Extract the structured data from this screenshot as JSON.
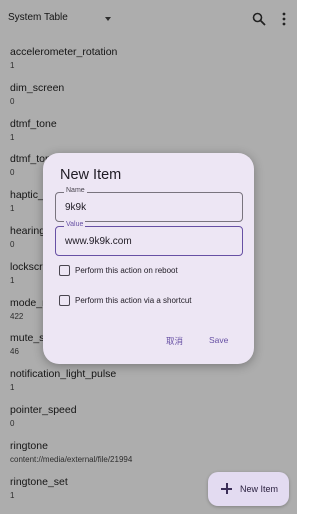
{
  "toolbar": {
    "table_selector": "System Table",
    "icons": [
      "chevron-down-icon",
      "search-icon",
      "more-vert-icon"
    ]
  },
  "settings": [
    {
      "key": "accelerometer_rotation",
      "value": "1"
    },
    {
      "key": "dim_screen",
      "value": "0"
    },
    {
      "key": "dtmf_tone",
      "value": "1"
    },
    {
      "key": "dtmf_tone_type",
      "value": "0"
    },
    {
      "key": "haptic_feedback_enabled",
      "value": "1"
    },
    {
      "key": "hearing_aid",
      "value": "0"
    },
    {
      "key": "lockscreen_sounds_enabled",
      "value": "1"
    },
    {
      "key": "mode_ringer_streams_affected",
      "value": "422"
    },
    {
      "key": "mute_streams_affected",
      "value": "46"
    },
    {
      "key": "notification_light_pulse",
      "value": "1"
    },
    {
      "key": "pointer_speed",
      "value": "0"
    },
    {
      "key": "ringtone",
      "value": "content://media/external/file/21994"
    },
    {
      "key": "ringtone_set",
      "value": "1"
    }
  ],
  "dialog": {
    "title": "New Item",
    "name_label": "Name",
    "name_value": "9k9k",
    "value_label": "Value",
    "value_value": "www.9k9k.com",
    "option_reboot": "Perform this action on reboot",
    "option_shortcut": "Perform this action via a shortcut",
    "cancel_label": "取消",
    "save_label": "Save"
  },
  "fab": {
    "label": "New Item"
  },
  "colors": {
    "accent": "#6750a4",
    "dialog_bg": "#ede6f4",
    "fab_bg": "#e3dbf1"
  }
}
